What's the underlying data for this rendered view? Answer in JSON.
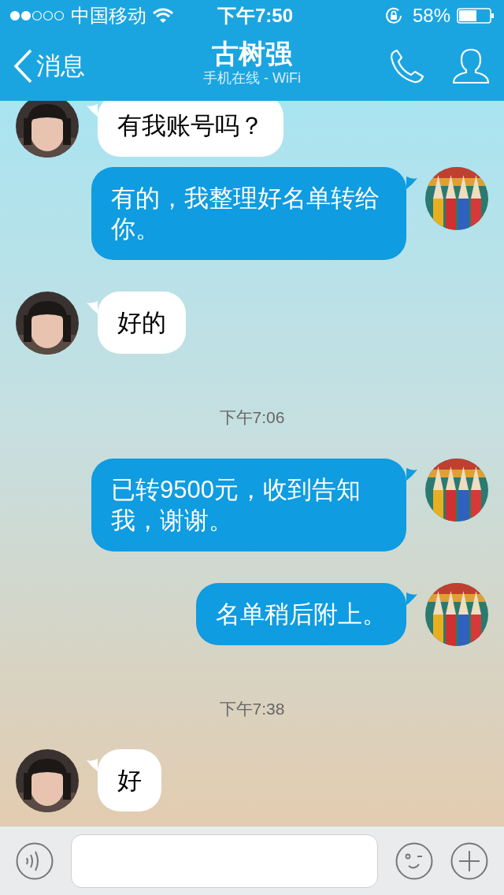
{
  "status_bar": {
    "carrier": "中国移动",
    "time": "下午7:50",
    "battery": "58%"
  },
  "header": {
    "back": "消息",
    "title": "古树强",
    "subtitle": "手机在线 - WiFi"
  },
  "messages": [
    {
      "kind": "received",
      "text": "有我账号吗？"
    },
    {
      "kind": "sent",
      "text": "有的，我整理好名单转给你。"
    },
    {
      "kind": "received",
      "text": "好的"
    },
    {
      "kind": "time",
      "text": "下午7:06"
    },
    {
      "kind": "sent",
      "text": "已转9500元，收到告知我，谢谢。"
    },
    {
      "kind": "sent",
      "text": "名单稍后附上。"
    },
    {
      "kind": "time",
      "text": "下午7:38"
    },
    {
      "kind": "received",
      "text": "好"
    }
  ]
}
